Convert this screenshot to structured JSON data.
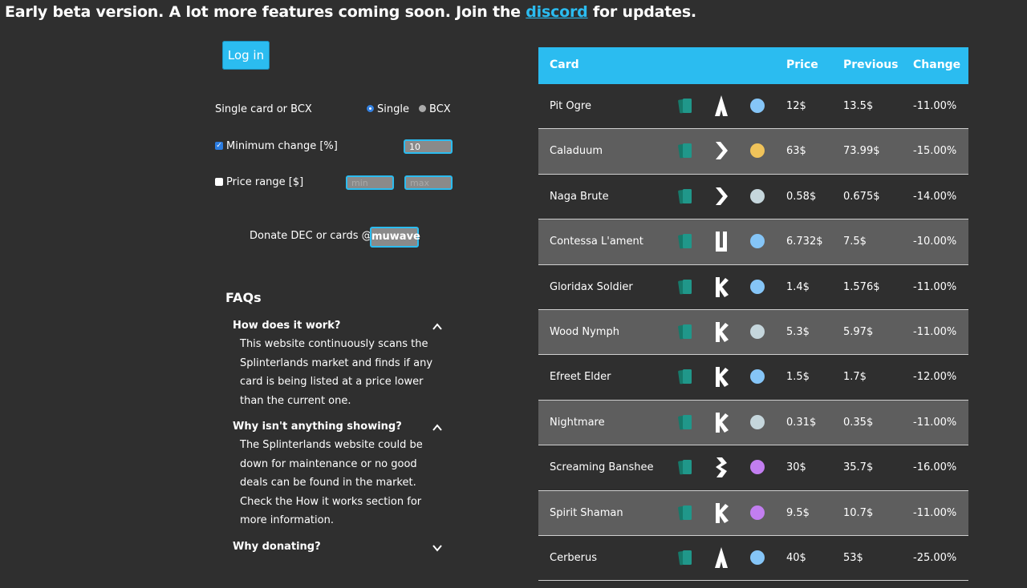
{
  "banner": {
    "prefix": "Early beta version. A lot more features coming soon. Join the ",
    "link": "discord",
    "suffix": " for updates."
  },
  "login": {
    "label": "Log in"
  },
  "filters": {
    "mode_label": "Single card or BCX",
    "radio_single": "Single",
    "radio_bcx": "BCX",
    "min_change_label": "Minimum change [%]",
    "min_change_value": "10",
    "price_range_label": "Price range [$]",
    "price_min_placeholder": "min",
    "price_max_placeholder": "max"
  },
  "donate": {
    "label": "Donate DEC or cards @",
    "account": "muwave"
  },
  "faq": {
    "title": "FAQs",
    "items": [
      {
        "q": "How does it work?",
        "a": "This website continuously scans the Splinterlands market and finds if any card is being listed at a price lower than the current one."
      },
      {
        "q": "Why isn't anything showing?",
        "a": "The Splinterlands website could be down for maintenance or no good deals can be found in the market. Check the How it works section for more information."
      },
      {
        "q": "Why donating?",
        "a": ""
      }
    ]
  },
  "table": {
    "headers": {
      "card": "Card",
      "price": "Price",
      "previous": "Previous",
      "change": "Change"
    },
    "colors": {
      "blue": "#85c5f7",
      "gold": "#f0c35a",
      "silver": "#c5d6dc",
      "purple": "#c27ef0",
      "teal": "#1f8a7a",
      "header": "#2bbcf0"
    },
    "rows": [
      {
        "name": "Pit Ogre",
        "type": "arrow-up-icon",
        "rarity": "blue",
        "price": "12$",
        "previous": "13.5$",
        "change": "-11.00%"
      },
      {
        "name": "Caladuum",
        "type": "chevron-right-icon",
        "rarity": "gold",
        "price": "63$",
        "previous": "73.99$",
        "change": "-15.00%"
      },
      {
        "name": "Naga Brute",
        "type": "chevron-right-icon",
        "rarity": "silver",
        "price": "0.58$",
        "previous": "0.675$",
        "change": "-14.00%"
      },
      {
        "name": "Contessa L'ament",
        "type": "pillar-icon",
        "rarity": "blue",
        "price": "6.732$",
        "previous": "7.5$",
        "change": "-10.00%"
      },
      {
        "name": "Gloridax Soldier",
        "type": "k-rune-icon",
        "rarity": "blue",
        "price": "1.4$",
        "previous": "1.576$",
        "change": "-11.00%"
      },
      {
        "name": "Wood Nymph",
        "type": "k-rune-icon",
        "rarity": "silver",
        "price": "5.3$",
        "previous": "5.97$",
        "change": "-11.00%"
      },
      {
        "name": "Efreet Elder",
        "type": "k-rune-icon",
        "rarity": "blue",
        "price": "1.5$",
        "previous": "1.7$",
        "change": "-12.00%"
      },
      {
        "name": "Nightmare",
        "type": "k-rune-icon",
        "rarity": "silver",
        "price": "0.31$",
        "previous": "0.35$",
        "change": "-11.00%"
      },
      {
        "name": "Screaming Banshee",
        "type": "lightning-icon",
        "rarity": "purple",
        "price": "30$",
        "previous": "35.7$",
        "change": "-16.00%"
      },
      {
        "name": "Spirit Shaman",
        "type": "k-rune-icon",
        "rarity": "purple",
        "price": "9.5$",
        "previous": "10.7$",
        "change": "-11.00%"
      },
      {
        "name": "Cerberus",
        "type": "arrow-up-icon",
        "rarity": "blue",
        "price": "40$",
        "previous": "53$",
        "change": "-25.00%"
      }
    ]
  }
}
